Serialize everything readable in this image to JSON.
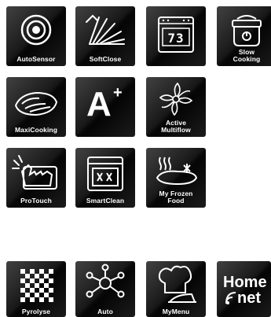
{
  "features": [
    {
      "id": "autosensor",
      "label": "AutoSensor",
      "icon": "target-icon"
    },
    {
      "id": "softclose",
      "label": "SoftClose",
      "icon": "soft-close-door-icon"
    },
    {
      "id": "display",
      "display_value": "73",
      "icon": "oven-display-icon"
    },
    {
      "id": "slowcooking",
      "label_line1": "Slow",
      "label_line2": "Cooking",
      "icon": "slow-cooker-icon"
    },
    {
      "id": "maxicooking",
      "label": "MaxiCooking",
      "icon": "baking-dish-icon"
    },
    {
      "id": "aplus",
      "label": "A",
      "sup": "+",
      "icon": "energy-class-icon"
    },
    {
      "id": "activemultiflow",
      "label_line1": "Active",
      "label_line2": "Multiflow",
      "icon": "fan-icon"
    },
    {
      "id": "protouch",
      "label": "ProTouch",
      "icon": "touch-glove-icon"
    },
    {
      "id": "smartclean",
      "label": "SmartClean",
      "icon": "oven-cleaning-icon"
    },
    {
      "id": "myfrozenfood",
      "label_line1": "My Frozen",
      "label_line2": "Food",
      "icon": "frozen-food-icon"
    },
    {
      "id": "pyrolyse",
      "label": "Pyrolyse",
      "icon": "checkerboard-icon"
    },
    {
      "id": "auto",
      "label": "Auto",
      "icon": "network-nodes-icon"
    },
    {
      "id": "mymenu",
      "label": "MyMenu",
      "icon": "chef-hat-icon"
    },
    {
      "id": "homenet",
      "line1": "Home",
      "line2": "net",
      "icon": "home-net-logo-icon"
    }
  ]
}
